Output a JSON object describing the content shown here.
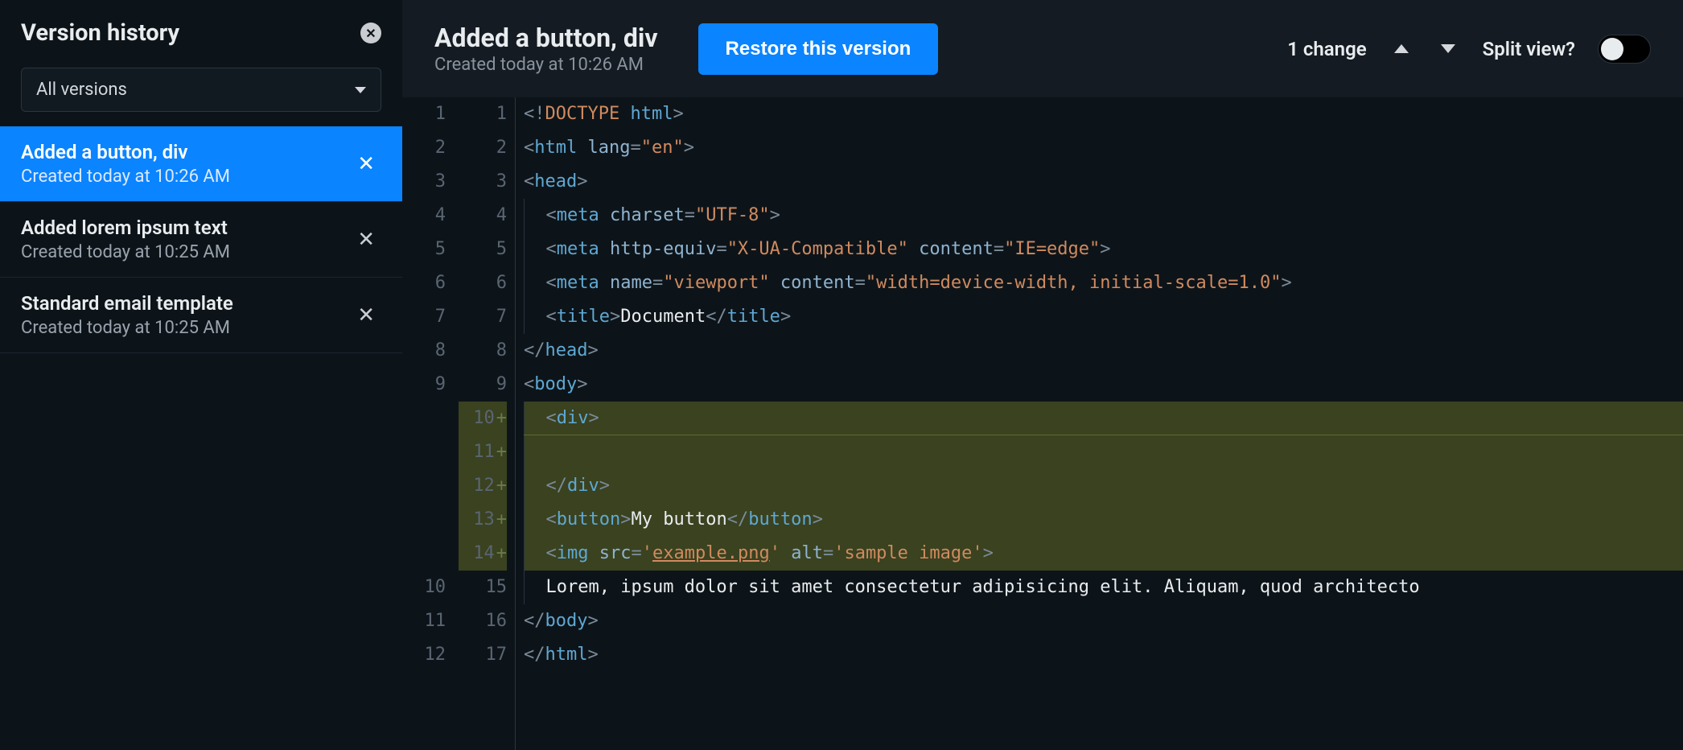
{
  "sidebar": {
    "title": "Version history",
    "filter_label": "All versions",
    "versions": [
      {
        "name": "Added a button, div",
        "date": "Created today at 10:26 AM",
        "selected": true
      },
      {
        "name": "Added lorem ipsum text",
        "date": "Created today at 10:25 AM",
        "selected": false
      },
      {
        "name": "Standard email template",
        "date": "Created today at 10:25 AM",
        "selected": false
      }
    ]
  },
  "header": {
    "title": "Added a button, div",
    "subtitle": "Created today at 10:26 AM",
    "restore_label": "Restore this version",
    "changes_label": "1 change",
    "split_label": "Split view?"
  },
  "diff": {
    "lines": [
      {
        "left": "1",
        "right": "1",
        "added": false,
        "tokens": [
          [
            "punc",
            "<!"
          ],
          [
            "doctype",
            "DOCTYPE"
          ],
          [
            "text",
            " "
          ],
          [
            "tag",
            "html"
          ],
          [
            "punc",
            ">"
          ]
        ]
      },
      {
        "left": "2",
        "right": "2",
        "added": false,
        "tokens": [
          [
            "punc",
            "<"
          ],
          [
            "tag",
            "html"
          ],
          [
            "text",
            " "
          ],
          [
            "attr",
            "lang"
          ],
          [
            "punc",
            "="
          ],
          [
            "str",
            "\"en\""
          ],
          [
            "punc",
            ">"
          ]
        ]
      },
      {
        "left": "3",
        "right": "3",
        "added": false,
        "tokens": [
          [
            "punc",
            "<"
          ],
          [
            "tag",
            "head"
          ],
          [
            "punc",
            ">"
          ]
        ]
      },
      {
        "left": "4",
        "right": "4",
        "added": false,
        "indent": 1,
        "tokens": [
          [
            "punc",
            "<"
          ],
          [
            "tag",
            "meta"
          ],
          [
            "text",
            " "
          ],
          [
            "attr",
            "charset"
          ],
          [
            "punc",
            "="
          ],
          [
            "str",
            "\"UTF-8\""
          ],
          [
            "punc",
            ">"
          ]
        ]
      },
      {
        "left": "5",
        "right": "5",
        "added": false,
        "indent": 1,
        "tokens": [
          [
            "punc",
            "<"
          ],
          [
            "tag",
            "meta"
          ],
          [
            "text",
            " "
          ],
          [
            "attr",
            "http-equiv"
          ],
          [
            "punc",
            "="
          ],
          [
            "str",
            "\"X-UA-Compatible\""
          ],
          [
            "text",
            " "
          ],
          [
            "attr",
            "content"
          ],
          [
            "punc",
            "="
          ],
          [
            "str",
            "\"IE=edge\""
          ],
          [
            "punc",
            ">"
          ]
        ]
      },
      {
        "left": "6",
        "right": "6",
        "added": false,
        "indent": 1,
        "tokens": [
          [
            "punc",
            "<"
          ],
          [
            "tag",
            "meta"
          ],
          [
            "text",
            " "
          ],
          [
            "attr",
            "name"
          ],
          [
            "punc",
            "="
          ],
          [
            "str",
            "\"viewport\""
          ],
          [
            "text",
            " "
          ],
          [
            "attr",
            "content"
          ],
          [
            "punc",
            "="
          ],
          [
            "str",
            "\"width=device-width, initial-scale=1.0\""
          ],
          [
            "punc",
            ">"
          ]
        ]
      },
      {
        "left": "7",
        "right": "7",
        "added": false,
        "indent": 1,
        "tokens": [
          [
            "punc",
            "<"
          ],
          [
            "tag",
            "title"
          ],
          [
            "punc",
            ">"
          ],
          [
            "text",
            "Document"
          ],
          [
            "punc",
            "</"
          ],
          [
            "tag",
            "title"
          ],
          [
            "punc",
            ">"
          ]
        ]
      },
      {
        "left": "8",
        "right": "8",
        "added": false,
        "tokens": [
          [
            "punc",
            "</"
          ],
          [
            "tag",
            "head"
          ],
          [
            "punc",
            ">"
          ]
        ]
      },
      {
        "left": "9",
        "right": "9",
        "added": false,
        "tokens": [
          [
            "punc",
            "<"
          ],
          [
            "tag",
            "body"
          ],
          [
            "punc",
            ">"
          ]
        ]
      },
      {
        "left": "",
        "right": "10",
        "added": true,
        "added_first": true,
        "indent": 1,
        "tokens": [
          [
            "punc",
            "<"
          ],
          [
            "tag",
            "div"
          ],
          [
            "punc",
            ">"
          ]
        ]
      },
      {
        "left": "",
        "right": "11",
        "added": true,
        "indent": 1,
        "tokens": []
      },
      {
        "left": "",
        "right": "12",
        "added": true,
        "indent": 1,
        "tokens": [
          [
            "punc",
            "</"
          ],
          [
            "tag",
            "div"
          ],
          [
            "punc",
            ">"
          ]
        ]
      },
      {
        "left": "",
        "right": "13",
        "added": true,
        "indent": 1,
        "tokens": [
          [
            "punc",
            "<"
          ],
          [
            "tag",
            "button"
          ],
          [
            "punc",
            ">"
          ],
          [
            "text",
            "My button"
          ],
          [
            "punc",
            "</"
          ],
          [
            "tag",
            "button"
          ],
          [
            "punc",
            ">"
          ]
        ]
      },
      {
        "left": "",
        "right": "14",
        "added": true,
        "indent": 1,
        "tokens": [
          [
            "punc",
            "<"
          ],
          [
            "tag",
            "img"
          ],
          [
            "text",
            " "
          ],
          [
            "attr",
            "src"
          ],
          [
            "punc",
            "="
          ],
          [
            "str",
            "'"
          ],
          [
            "str-ul",
            "example.png"
          ],
          [
            "str",
            "'"
          ],
          [
            "text",
            " "
          ],
          [
            "attr",
            "alt"
          ],
          [
            "punc",
            "="
          ],
          [
            "str",
            "'sample image'"
          ],
          [
            "punc",
            ">"
          ]
        ]
      },
      {
        "left": "10",
        "right": "15",
        "added": false,
        "indent": 1,
        "tokens": [
          [
            "text",
            "Lorem, ipsum dolor sit amet consectetur adipisicing elit. Aliquam, quod architecto"
          ]
        ]
      },
      {
        "left": "11",
        "right": "16",
        "added": false,
        "tokens": [
          [
            "punc",
            "</"
          ],
          [
            "tag",
            "body"
          ],
          [
            "punc",
            ">"
          ]
        ]
      },
      {
        "left": "12",
        "right": "17",
        "added": false,
        "tokens": [
          [
            "punc",
            "</"
          ],
          [
            "tag",
            "html"
          ],
          [
            "punc",
            ">"
          ]
        ]
      }
    ]
  }
}
